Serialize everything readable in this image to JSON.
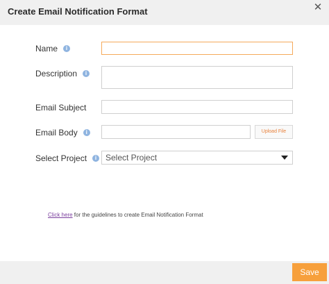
{
  "dialog": {
    "title": "Create Email Notification Format",
    "close_glyph": "✕"
  },
  "form": {
    "name": {
      "label": "Name",
      "value": "",
      "info_icon": "info-icon"
    },
    "description": {
      "label": "Description",
      "value": "",
      "info_icon": "info-icon"
    },
    "email_subject": {
      "label": "Email Subject",
      "value": ""
    },
    "email_body": {
      "label": "Email Body",
      "value": "",
      "info_icon": "info-icon",
      "upload_label": "Upload File"
    },
    "select_project": {
      "label": "Select Project",
      "selected": "Select Project",
      "info_icon": "info-icon"
    }
  },
  "guideline": {
    "link_text": "Click here",
    "text": " for the guidelines to create Email Notification Format"
  },
  "footer": {
    "save_label": "Save"
  },
  "colors": {
    "accent": "#f7a03c",
    "focus_border": "#f5a95a",
    "info_icon": "#8fb4e0",
    "link": "#7a3e9d",
    "header_bg": "#f0f0f0"
  }
}
